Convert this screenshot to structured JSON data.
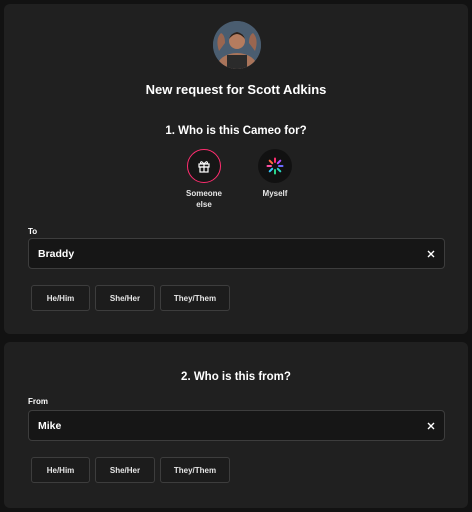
{
  "header": {
    "title": "New request for Scott Adkins"
  },
  "recipient": {
    "heading": "1. Who is this Cameo for?",
    "choices": [
      {
        "label": "Someone else",
        "selected": true,
        "icon": "gift-icon"
      },
      {
        "label": "Myself",
        "selected": false,
        "icon": "spinner-icon"
      }
    ],
    "to_label": "To",
    "to_value": "Braddy",
    "pronouns": [
      "He/Him",
      "She/Her",
      "They/Them"
    ]
  },
  "sender": {
    "heading": "2. Who is this from?",
    "from_label": "From",
    "from_value": "Mike",
    "pronouns": [
      "He/Him",
      "She/Her",
      "They/Them"
    ]
  },
  "colors": {
    "accent": "#ff2d6f",
    "card": "#202020",
    "background": "#121212"
  }
}
